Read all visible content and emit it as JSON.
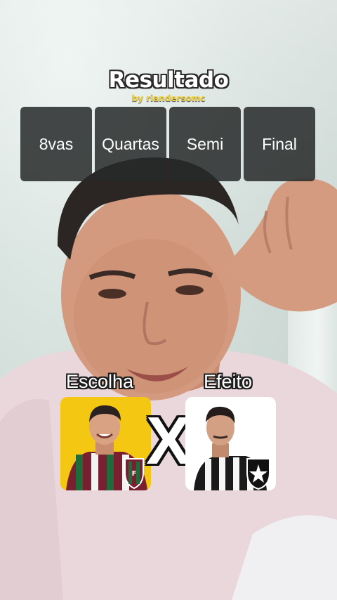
{
  "header": {
    "title": "Resultado",
    "byline": "by riandersomc"
  },
  "rounds": [
    {
      "label": "8vas"
    },
    {
      "label": "Quartas"
    },
    {
      "label": "Semi"
    },
    {
      "label": "Final"
    }
  ],
  "matchup": {
    "left_label": "Escolha",
    "right_label": "Efeito",
    "versus": "X"
  },
  "colors": {
    "left_card_bg": "#f4c713",
    "right_card_bg": "#ffffff",
    "tab_bg": "#262a2a",
    "byline": "#f2d23a"
  }
}
